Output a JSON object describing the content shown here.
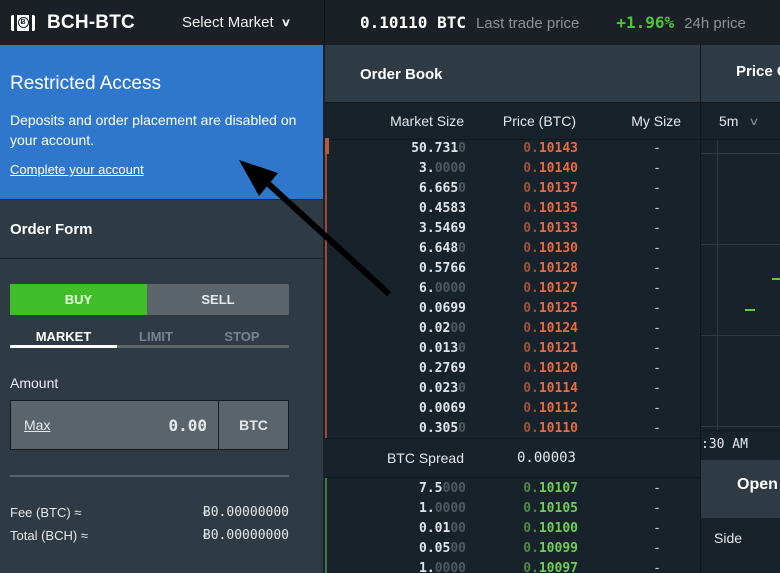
{
  "header": {
    "logo_icon": "bitcoin-cash-icon",
    "pair": "BCH-BTC",
    "select_market": "Select Market",
    "last_price": "0.10110 BTC",
    "last_price_label": "Last trade price",
    "change_24h": "+1.96%",
    "change_label": "24h price"
  },
  "restricted": {
    "title": "Restricted Access",
    "message": "Deposits and order placement are disabled on your account.",
    "link": "Complete your account"
  },
  "order_form": {
    "title": "Order Form",
    "buy": "BUY",
    "sell": "SELL",
    "tabs": [
      "MARKET",
      "LIMIT",
      "STOP"
    ],
    "active_tab": "MARKET",
    "amount_label": "Amount",
    "max_label": "Max",
    "amount_value": "0.00",
    "amount_unit": "BTC",
    "fee_label": "Fee (BTC) ≈",
    "fee_value": "ɃO.00000000",
    "total_label": "Total (BCH) ≈",
    "total_value": "Ƀ0.00000000"
  },
  "order_book": {
    "title": "Order Book",
    "columns": [
      "Market Size",
      "Price (BTC)",
      "My Size"
    ],
    "asks": [
      {
        "size": "50.731",
        "size_dim": "0",
        "price_dim": "0.",
        "price": "10143",
        "my": "-"
      },
      {
        "size": "3.",
        "size_dim": "0000",
        "price_dim": "0.",
        "price": "10140",
        "my": "-"
      },
      {
        "size": "6.665",
        "size_dim": "0",
        "price_dim": "0.",
        "price": "10137",
        "my": "-"
      },
      {
        "size": "0.4583",
        "size_dim": "",
        "price_dim": "0.",
        "price": "10135",
        "my": "-"
      },
      {
        "size": "3.5469",
        "size_dim": "",
        "price_dim": "0.",
        "price": "10133",
        "my": "-"
      },
      {
        "size": "6.648",
        "size_dim": "0",
        "price_dim": "0.",
        "price": "10130",
        "my": "-"
      },
      {
        "size": "0.5766",
        "size_dim": "",
        "price_dim": "0.",
        "price": "10128",
        "my": "-"
      },
      {
        "size": "6.",
        "size_dim": "0000",
        "price_dim": "0.",
        "price": "10127",
        "my": "-"
      },
      {
        "size": "0.0699",
        "size_dim": "",
        "price_dim": "0.",
        "price": "10125",
        "my": "-"
      },
      {
        "size": "0.02",
        "size_dim": "00",
        "price_dim": "0.",
        "price": "10124",
        "my": "-"
      },
      {
        "size": "0.013",
        "size_dim": "0",
        "price_dim": "0.",
        "price": "10121",
        "my": "-"
      },
      {
        "size": "0.2769",
        "size_dim": "",
        "price_dim": "0.",
        "price": "10120",
        "my": "-"
      },
      {
        "size": "0.023",
        "size_dim": "0",
        "price_dim": "0.",
        "price": "10114",
        "my": "-"
      },
      {
        "size": "0.0069",
        "size_dim": "",
        "price_dim": "0.",
        "price": "10112",
        "my": "-"
      },
      {
        "size": "0.305",
        "size_dim": "0",
        "price_dim": "0.",
        "price": "10110",
        "my": "-"
      }
    ],
    "spread_label": "BTC Spread",
    "spread_value": "0.00003",
    "bids": [
      {
        "size": "7.5",
        "size_dim": "000",
        "price_dim": "0.",
        "price": "10107",
        "my": "-"
      },
      {
        "size": "1.",
        "size_dim": "0000",
        "price_dim": "0.",
        "price": "10105",
        "my": "-"
      },
      {
        "size": "0.01",
        "size_dim": "00",
        "price_dim": "0.",
        "price": "10100",
        "my": "-"
      },
      {
        "size": "0.05",
        "size_dim": "00",
        "price_dim": "0.",
        "price": "10099",
        "my": "-"
      },
      {
        "size": "1.",
        "size_dim": "0000",
        "price_dim": "0.",
        "price": "10097",
        "my": "-"
      }
    ]
  },
  "chart": {
    "title": "Price C",
    "interval": "5m",
    "time_label": ":30 AM"
  },
  "open_orders": {
    "title": "Open",
    "side_label": "Side"
  },
  "colors": {
    "accent_blue": "#2f77cc",
    "buy_green": "#42bd2a",
    "ask_red": "#ea6b3e",
    "bid_green": "#6ed157",
    "change_green": "#4cc53b"
  }
}
